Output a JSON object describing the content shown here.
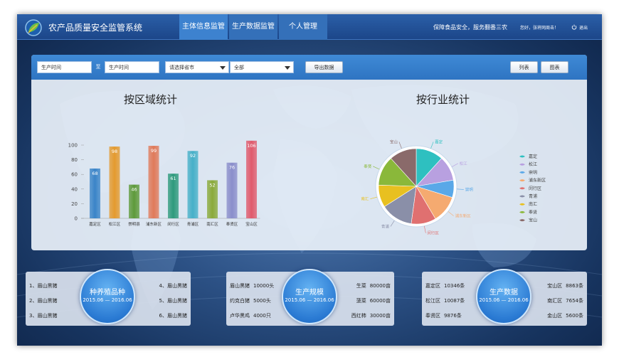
{
  "header": {
    "app_title": "农产品质量安全监管系统",
    "nav": [
      "主体信息监管",
      "生产数据监管",
      "个人管理"
    ],
    "slogan": "保障食品安全，服务翻番三农",
    "greeting": "您好，张将网周击！",
    "logout": "退出"
  },
  "toolbar": {
    "date_start": "生产时间",
    "range_sep": "至",
    "date_end": "生产时间",
    "province_select": "请选择省市",
    "all_select": "全部",
    "export": "导出数据",
    "list": "列表",
    "chart": "图表"
  },
  "region_chart_title": "按区域统计",
  "industry_chart_title": "按行业统计",
  "chart_data": [
    {
      "type": "bar",
      "title": "按区域统计",
      "categories": [
        "嘉定区",
        "松江区",
        "崇明县",
        "浦东新区",
        "闵行区",
        "青浦区",
        "南汇区",
        "奉贤区",
        "宝山区"
      ],
      "values": [
        68,
        98,
        46,
        99,
        61,
        92,
        52,
        76,
        106
      ],
      "colors": [
        "#3a84c8",
        "#e49a2e",
        "#5e9a3a",
        "#e07a5a",
        "#2e9a7c",
        "#46b0c8",
        "#8aaa3a",
        "#8a8ecb",
        "#e05a6c"
      ],
      "ylim": [
        0,
        100
      ],
      "yticks": [
        0,
        20,
        40,
        60,
        80,
        100
      ]
    },
    {
      "type": "pie",
      "title": "按行业统计",
      "labels": [
        "嘉定",
        "松江",
        "崇明",
        "浦东新区",
        "闵行区",
        "青浦",
        "南汇",
        "奉贤",
        "宝山"
      ],
      "values": [
        11,
        10,
        7,
        11,
        10,
        13,
        9,
        12,
        11
      ],
      "colors": [
        "#2ec0c0",
        "#b8a0e0",
        "#5aa8e8",
        "#f5aa70",
        "#e07070",
        "#8a8fa8",
        "#e8c020",
        "#8ab83a",
        "#8a6a6a"
      ]
    }
  ],
  "cards": [
    {
      "title": "种养殖品种",
      "date": "2015.06 — 2016.06",
      "left": [
        "1、眉山黑猪",
        "2、眉山黑猪",
        "3、眉山黑猪"
      ],
      "right": [
        "4、眉山黑猪",
        "5、眉山黑猪",
        "6、眉山黑猪"
      ]
    },
    {
      "title": "生产规模",
      "date": "2015.06 — 2016.06",
      "left": [
        [
          "眉山黑猪",
          "10000头"
        ],
        [
          "约克白猪",
          "5000头"
        ],
        [
          "卢华黑鸡",
          "4000只"
        ]
      ],
      "right": [
        [
          "生菜",
          "80000亩"
        ],
        [
          "菠菜",
          "60000亩"
        ],
        [
          "西红柿",
          "30000亩"
        ]
      ]
    },
    {
      "title": "生产数据",
      "date": "2015.06 — 2016.06",
      "left": [
        [
          "嘉定区",
          "10346条"
        ],
        [
          "松江区",
          "10087条"
        ],
        [
          "奉贤区",
          "9876条"
        ]
      ],
      "right": [
        [
          "宝山区",
          "8863条"
        ],
        [
          "南汇区",
          "7654条"
        ],
        [
          "金山区",
          "5600条"
        ]
      ]
    }
  ],
  "icons": {
    "logo": "leaf-globe-logo-icon",
    "logout": "power-icon",
    "arrow": "chevron-down-icon"
  }
}
